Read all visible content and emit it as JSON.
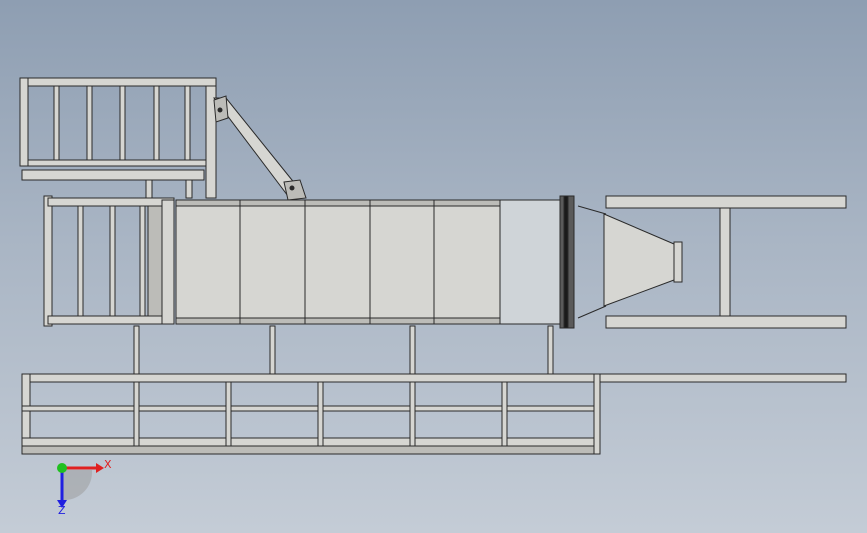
{
  "viewport": {
    "background_top": "#8e9eb2",
    "background_bottom": "#c4ccd6"
  },
  "model": {
    "line_color": "#2a2a2a",
    "fill_color": "#d6d6d2",
    "shade_color": "#bcbcb8"
  },
  "triad": {
    "x_label": "X",
    "z_label": "Z",
    "x_color": "#e02020",
    "y_color": "#20c020",
    "z_color": "#2020e0"
  }
}
